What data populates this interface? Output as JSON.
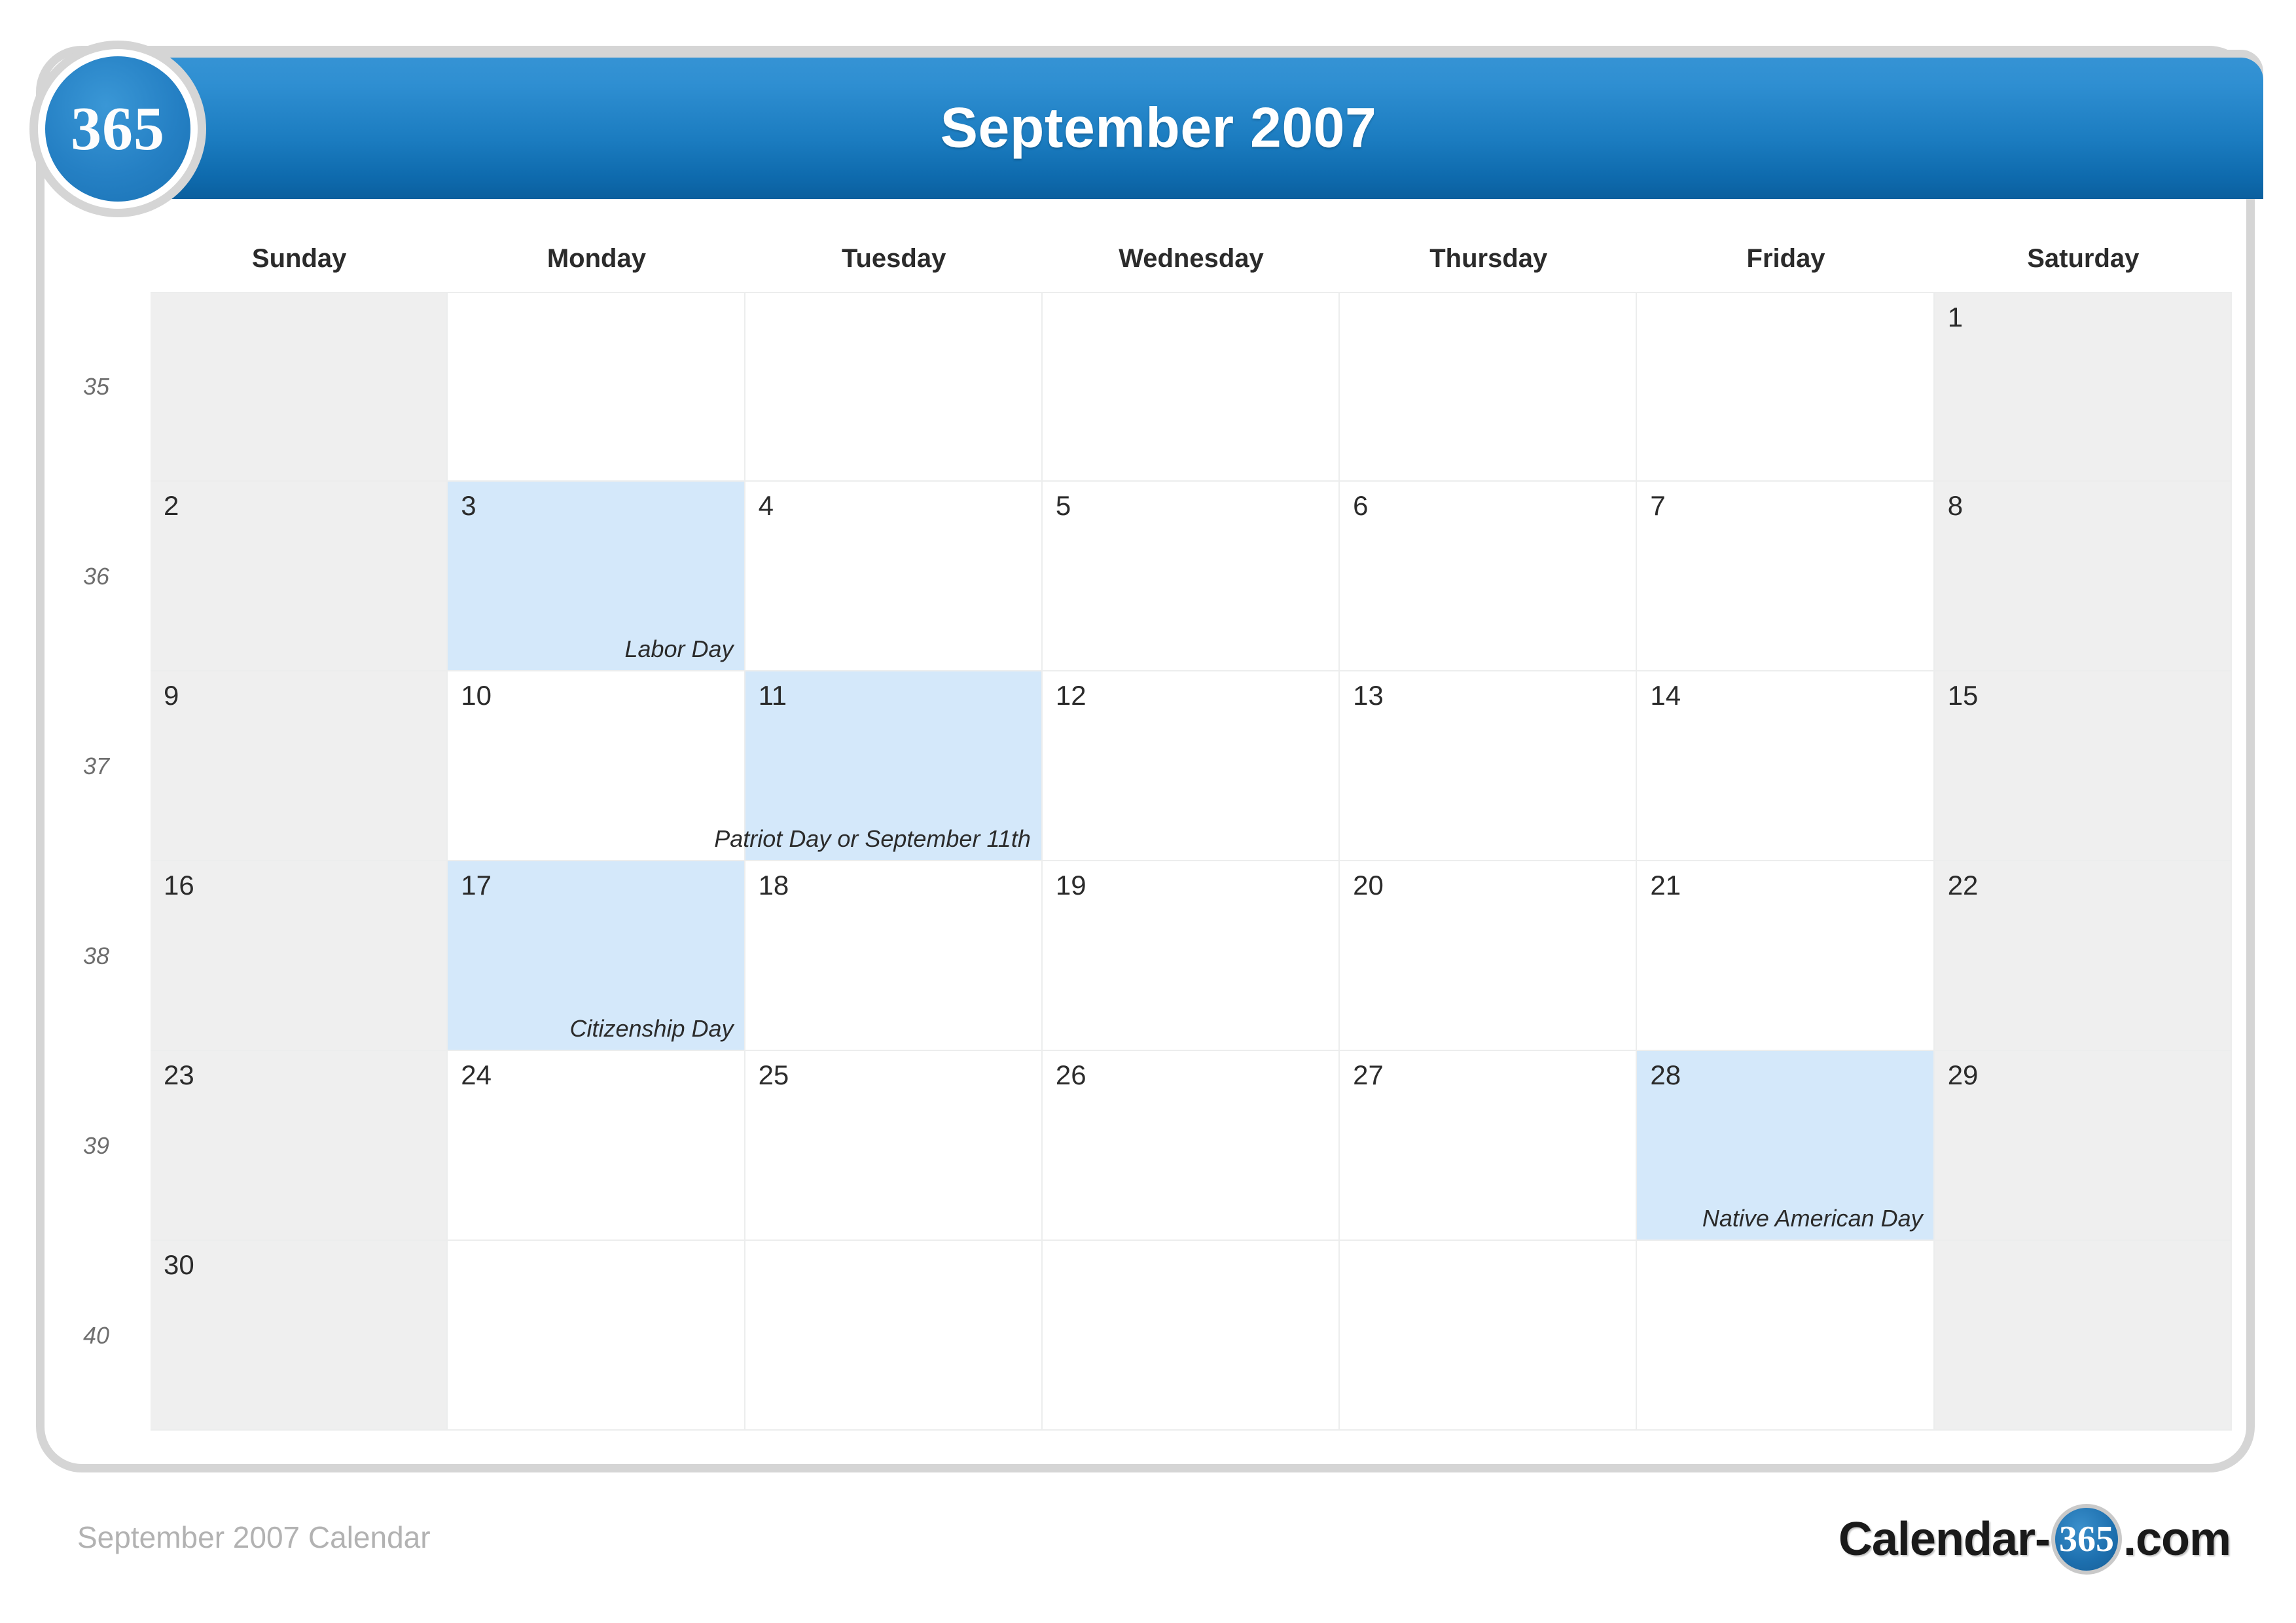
{
  "brand": {
    "badge_text": "365",
    "logo_prefix": "Calendar-",
    "logo_disc": "365",
    "logo_suffix": ".com"
  },
  "header": {
    "title": "September 2007"
  },
  "watermark": {
    "text": "365"
  },
  "calendar": {
    "weekdays": [
      "Sunday",
      "Monday",
      "Tuesday",
      "Wednesday",
      "Thursday",
      "Friday",
      "Saturday"
    ],
    "week_numbers": [
      "35",
      "36",
      "37",
      "38",
      "39",
      "40"
    ],
    "colors": {
      "header_blue": "#1b7cc0",
      "weekend_gray": "#efefef",
      "holiday_blue": "#d4e8fa",
      "grid_line": "#eceded",
      "frame_gray": "#d5d5d5"
    },
    "weeks": [
      {
        "week_number": "35",
        "days": [
          {
            "num": "",
            "type": "weekend",
            "holiday": ""
          },
          {
            "num": "",
            "type": "weekday",
            "holiday": ""
          },
          {
            "num": "",
            "type": "weekday",
            "holiday": ""
          },
          {
            "num": "",
            "type": "weekday",
            "holiday": ""
          },
          {
            "num": "",
            "type": "weekday",
            "holiday": ""
          },
          {
            "num": "",
            "type": "weekday",
            "holiday": ""
          },
          {
            "num": "1",
            "type": "weekend",
            "holiday": ""
          }
        ]
      },
      {
        "week_number": "36",
        "days": [
          {
            "num": "2",
            "type": "weekend",
            "holiday": ""
          },
          {
            "num": "3",
            "type": "holiday",
            "holiday": "Labor Day"
          },
          {
            "num": "4",
            "type": "weekday",
            "holiday": ""
          },
          {
            "num": "5",
            "type": "weekday",
            "holiday": ""
          },
          {
            "num": "6",
            "type": "weekday",
            "holiday": ""
          },
          {
            "num": "7",
            "type": "weekday",
            "holiday": ""
          },
          {
            "num": "8",
            "type": "weekend",
            "holiday": ""
          }
        ]
      },
      {
        "week_number": "37",
        "days": [
          {
            "num": "9",
            "type": "weekend",
            "holiday": ""
          },
          {
            "num": "10",
            "type": "weekday",
            "holiday": ""
          },
          {
            "num": "11",
            "type": "holiday",
            "holiday": "Patriot Day or September 11th"
          },
          {
            "num": "12",
            "type": "weekday",
            "holiday": ""
          },
          {
            "num": "13",
            "type": "weekday",
            "holiday": ""
          },
          {
            "num": "14",
            "type": "weekday",
            "holiday": ""
          },
          {
            "num": "15",
            "type": "weekend",
            "holiday": ""
          }
        ]
      },
      {
        "week_number": "38",
        "days": [
          {
            "num": "16",
            "type": "weekend",
            "holiday": ""
          },
          {
            "num": "17",
            "type": "holiday",
            "holiday": "Citizenship Day"
          },
          {
            "num": "18",
            "type": "weekday",
            "holiday": ""
          },
          {
            "num": "19",
            "type": "weekday",
            "holiday": ""
          },
          {
            "num": "20",
            "type": "weekday",
            "holiday": ""
          },
          {
            "num": "21",
            "type": "weekday",
            "holiday": ""
          },
          {
            "num": "22",
            "type": "weekend",
            "holiday": ""
          }
        ]
      },
      {
        "week_number": "39",
        "days": [
          {
            "num": "23",
            "type": "weekend",
            "holiday": ""
          },
          {
            "num": "24",
            "type": "weekday",
            "holiday": ""
          },
          {
            "num": "25",
            "type": "weekday",
            "holiday": ""
          },
          {
            "num": "26",
            "type": "weekday",
            "holiday": ""
          },
          {
            "num": "27",
            "type": "weekday",
            "holiday": ""
          },
          {
            "num": "28",
            "type": "holiday",
            "holiday": "Native American Day"
          },
          {
            "num": "29",
            "type": "weekend",
            "holiday": ""
          }
        ]
      },
      {
        "week_number": "40",
        "days": [
          {
            "num": "30",
            "type": "weekend",
            "holiday": ""
          },
          {
            "num": "",
            "type": "weekday",
            "holiday": ""
          },
          {
            "num": "",
            "type": "weekday",
            "holiday": ""
          },
          {
            "num": "",
            "type": "weekday",
            "holiday": ""
          },
          {
            "num": "",
            "type": "weekday",
            "holiday": ""
          },
          {
            "num": "",
            "type": "weekday",
            "holiday": ""
          },
          {
            "num": "",
            "type": "weekend",
            "holiday": ""
          }
        ]
      }
    ]
  },
  "footer": {
    "caption": "September 2007 Calendar"
  }
}
